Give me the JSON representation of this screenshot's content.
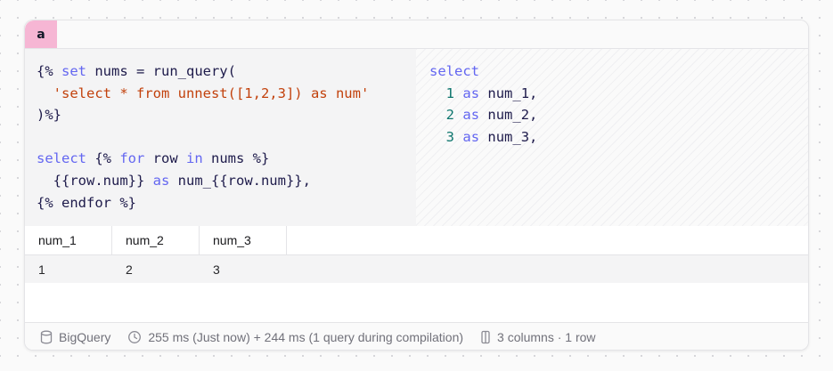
{
  "tab": {
    "label": "a"
  },
  "editor": {
    "source_lines": [
      [
        {
          "t": "{% "
        },
        {
          "t": "set",
          "c": "kw"
        },
        {
          "t": " nums = run_query("
        }
      ],
      [
        {
          "t": "  "
        },
        {
          "t": "'select * from unnest([1,2,3]) as num'",
          "c": "str"
        }
      ],
      [
        {
          "t": ")%}"
        }
      ],
      [
        {
          "t": ""
        }
      ],
      [
        {
          "t": "select",
          "c": "kw"
        },
        {
          "t": " {% "
        },
        {
          "t": "for",
          "c": "kw"
        },
        {
          "t": " row "
        },
        {
          "t": "in",
          "c": "kw"
        },
        {
          "t": " nums %}"
        }
      ],
      [
        {
          "t": "  {{row.num}} "
        },
        {
          "t": "as",
          "c": "kw"
        },
        {
          "t": " num_{{row.num}},"
        }
      ],
      [
        {
          "t": "{% endfor %}"
        }
      ]
    ],
    "compiled_lines": [
      [
        {
          "t": "select",
          "c": "kw"
        }
      ],
      [
        {
          "t": "  "
        },
        {
          "t": "1",
          "c": "num"
        },
        {
          "t": " "
        },
        {
          "t": "as",
          "c": "kw"
        },
        {
          "t": " num_1,"
        }
      ],
      [
        {
          "t": "  "
        },
        {
          "t": "2",
          "c": "num"
        },
        {
          "t": " "
        },
        {
          "t": "as",
          "c": "kw"
        },
        {
          "t": " num_2,"
        }
      ],
      [
        {
          "t": "  "
        },
        {
          "t": "3",
          "c": "num"
        },
        {
          "t": " "
        },
        {
          "t": "as",
          "c": "kw"
        },
        {
          "t": " num_3,"
        }
      ]
    ]
  },
  "results": {
    "columns": [
      "num_1",
      "num_2",
      "num_3"
    ],
    "rows": [
      [
        "1",
        "2",
        "3"
      ]
    ]
  },
  "footer": {
    "database_icon": "database-icon",
    "database": "BigQuery",
    "clock_icon": "clock-icon",
    "timing": "255 ms (Just now) + 244 ms (1 query during compilation)",
    "columns_icon": "columns-icon",
    "shape": "3 columns · 1 row"
  },
  "colors": {
    "tab_bg": "#f6b6d4",
    "keyword": "#6366f1",
    "string": "#c2410c",
    "number": "#0f766e",
    "code_text": "#1e1b4b"
  }
}
